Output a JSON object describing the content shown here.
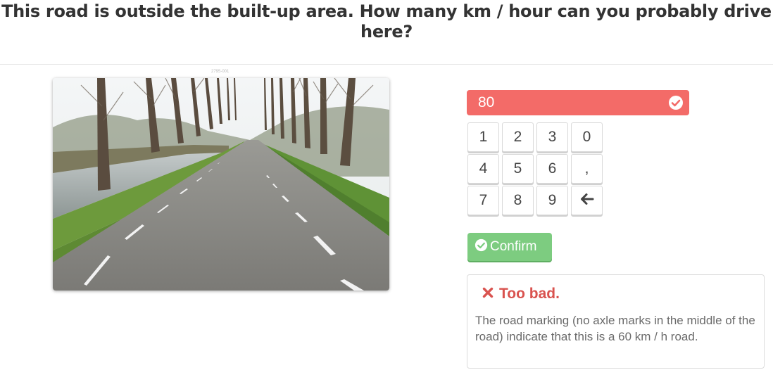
{
  "question": {
    "title": "This road is outside the built-up area. How many km / hour can you probably drive here?"
  },
  "image": {
    "tag": "2795-001",
    "alt": "Road with trees"
  },
  "answer": {
    "value": "80",
    "status": "incorrect",
    "icon": "check-circle-icon",
    "color": "#f36b68"
  },
  "keypad": {
    "keys": [
      "1",
      "2",
      "3",
      "0",
      "4",
      "5",
      "6",
      ",",
      "7",
      "8",
      "9"
    ],
    "backspace_icon": "arrow-left-icon"
  },
  "confirm": {
    "label": "Confirm",
    "icon": "check-circle-icon",
    "color": "#7dcc80"
  },
  "feedback": {
    "icon": "x-icon",
    "title": "Too bad.",
    "text": "The road marking (no axle marks in the middle of the road) indicate that this is a 60 km / h road.",
    "color": "#d9534f"
  }
}
